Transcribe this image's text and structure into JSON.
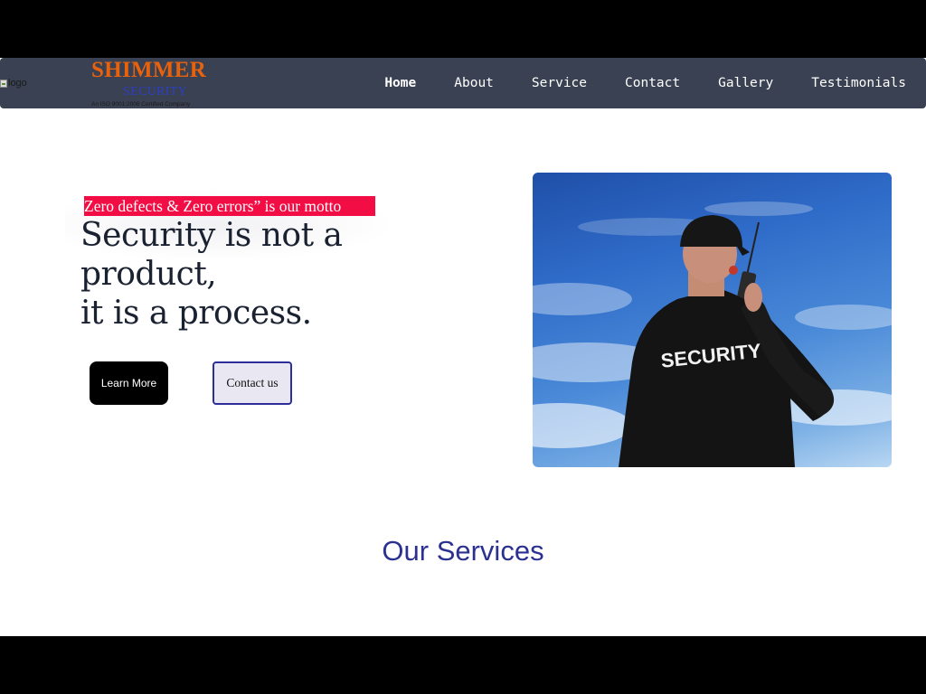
{
  "header": {
    "logo_alt": "logo",
    "brand_name": "SHIMMER",
    "brand_sub": "SECURITY",
    "brand_cert": "An ISO 9001:2008 Certified Company"
  },
  "nav": {
    "items": [
      {
        "label": "Home",
        "active": true
      },
      {
        "label": "About",
        "active": false
      },
      {
        "label": "Service",
        "active": false
      },
      {
        "label": "Contact",
        "active": false
      },
      {
        "label": "Gallery",
        "active": false
      },
      {
        "label": "Testimonials",
        "active": false
      }
    ]
  },
  "hero": {
    "motto": "Zero defects & Zero errors” is our motto",
    "headline_line1": "Security is not a",
    "headline_line2": "product,",
    "headline_line3": "it is a process.",
    "learn_more_label": "Learn More",
    "contact_label": "Contact us",
    "image_jacket_text": "SECURITY"
  },
  "services": {
    "title": "Our Services"
  },
  "colors": {
    "nav_bg": "#3a4152",
    "brand_orange": "#e8620d",
    "brand_blue": "#2c3fc4",
    "motto_bg": "#f20d44",
    "services_title": "#2b3191",
    "contact_border": "#2c2f9a"
  }
}
